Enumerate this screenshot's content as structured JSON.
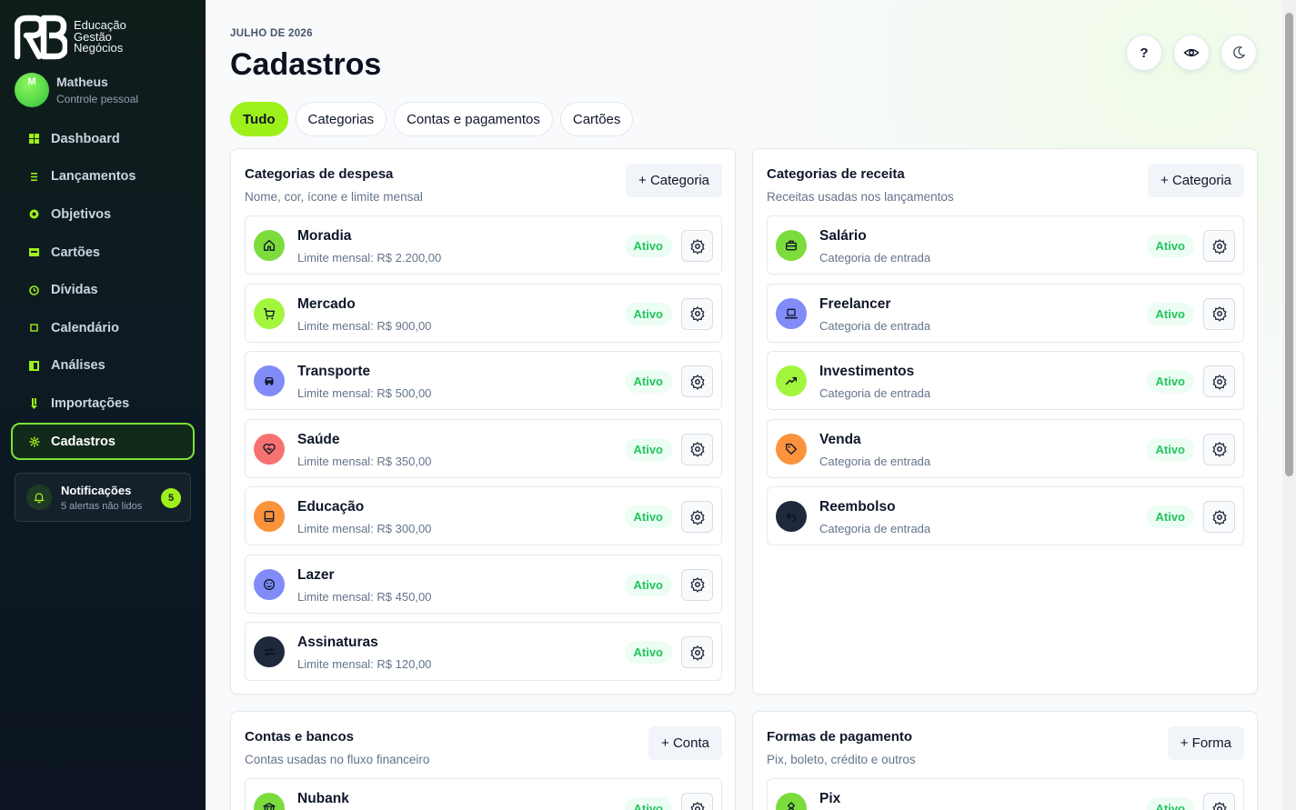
{
  "brand": {
    "lines": [
      "Educação",
      "Gestão",
      "Negócios"
    ]
  },
  "user": {
    "initial": "M",
    "name": "Matheus",
    "role": "Controle pessoal"
  },
  "sidebar": {
    "items": [
      {
        "label": "Dashboard",
        "icon": "grid-icon"
      },
      {
        "label": "Lançamentos",
        "icon": "list-icon"
      },
      {
        "label": "Objetivos",
        "icon": "target-icon"
      },
      {
        "label": "Cartões",
        "icon": "card-icon"
      },
      {
        "label": "Dívidas",
        "icon": "clock-icon"
      },
      {
        "label": "Calendário",
        "icon": "calendar-icon"
      },
      {
        "label": "Análises",
        "icon": "chart-icon"
      },
      {
        "label": "Importações",
        "icon": "download-icon"
      },
      {
        "label": "Cadastros",
        "icon": "gear-icon",
        "active": true
      }
    ]
  },
  "notifications": {
    "title": "Notificações",
    "subtitle": "5 alertas não lidos",
    "count": "5"
  },
  "header": {
    "eyebrow": "JULHO DE 2026",
    "title": "Cadastros"
  },
  "top_buttons": {
    "help": "?"
  },
  "tabs": [
    {
      "label": "Tudo",
      "active": true
    },
    {
      "label": "Categorias"
    },
    {
      "label": "Contas e pagamentos"
    },
    {
      "label": "Cartões"
    }
  ],
  "panels": {
    "expense": {
      "title": "Categorias de despesa",
      "subtitle": "Nome, cor, ícone e limite mensal",
      "add_label": "+ Categoria",
      "rows": [
        {
          "name": "Moradia",
          "detail": "Limite mensal: R$ 2.200,00",
          "status": "Ativo",
          "color": "#7bdc3c",
          "icon": "home-icon"
        },
        {
          "name": "Mercado",
          "detail": "Limite mensal: R$ 900,00",
          "status": "Ativo",
          "color": "#a3f53d",
          "icon": "cart-icon"
        },
        {
          "name": "Transporte",
          "detail": "Limite mensal: R$ 500,00",
          "status": "Ativo",
          "color": "#818cf8",
          "icon": "car-icon"
        },
        {
          "name": "Saúde",
          "detail": "Limite mensal: R$ 350,00",
          "status": "Ativo",
          "color": "#f87171",
          "icon": "heart-icon"
        },
        {
          "name": "Educação",
          "detail": "Limite mensal: R$ 300,00",
          "status": "Ativo",
          "color": "#fb923c",
          "icon": "book-icon"
        },
        {
          "name": "Lazer",
          "detail": "Limite mensal: R$ 450,00",
          "status": "Ativo",
          "color": "#818cf8",
          "icon": "smile-icon"
        },
        {
          "name": "Assinaturas",
          "detail": "Limite mensal: R$ 120,00",
          "status": "Ativo",
          "color": "#1e293b",
          "icon": "repeat-icon"
        }
      ]
    },
    "income": {
      "title": "Categorias de receita",
      "subtitle": "Receitas usadas nos lançamentos",
      "add_label": "+ Categoria",
      "rows": [
        {
          "name": "Salário",
          "detail": "Categoria de entrada",
          "status": "Ativo",
          "color": "#7bdc3c",
          "icon": "briefcase-icon"
        },
        {
          "name": "Freelancer",
          "detail": "Categoria de entrada",
          "status": "Ativo",
          "color": "#818cf8",
          "icon": "laptop-icon"
        },
        {
          "name": "Investimentos",
          "detail": "Categoria de entrada",
          "status": "Ativo",
          "color": "#a3f53d",
          "icon": "trend-up-icon"
        },
        {
          "name": "Venda",
          "detail": "Categoria de entrada",
          "status": "Ativo",
          "color": "#fb923c",
          "icon": "tag-icon"
        },
        {
          "name": "Reembolso",
          "detail": "Categoria de entrada",
          "status": "Ativo",
          "color": "#1e293b",
          "icon": "undo-icon"
        }
      ]
    },
    "accounts": {
      "title": "Contas e bancos",
      "subtitle": "Contas usadas no fluxo financeiro",
      "add_label": "+ Conta",
      "rows": [
        {
          "name": "Nubank",
          "status": "Ativo",
          "color": "#7bdc3c",
          "icon": "bank-icon"
        }
      ]
    },
    "payments": {
      "title": "Formas de pagamento",
      "subtitle": "Pix, boleto, crédito e outros",
      "add_label": "+ Forma",
      "rows": [
        {
          "name": "Pix",
          "status": "Ativo",
          "color": "#7bdc3c",
          "icon": "pix-icon"
        }
      ]
    }
  }
}
